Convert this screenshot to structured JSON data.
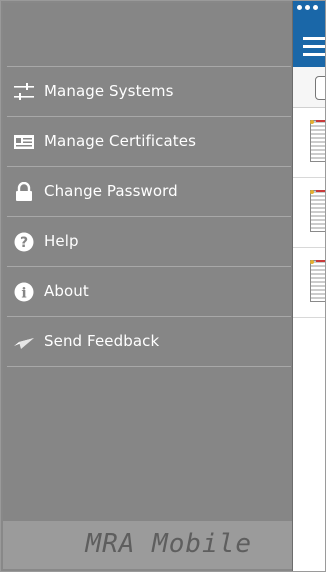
{
  "drawer": {
    "menu": [
      {
        "id": "manage-systems",
        "label": "Manage Systems",
        "icon": "sliders-icon"
      },
      {
        "id": "manage-certificates",
        "label": "Manage Certificates",
        "icon": "certificate-icon"
      },
      {
        "id": "change-password",
        "label": "Change Password",
        "icon": "lock-icon"
      },
      {
        "id": "help",
        "label": "Help",
        "icon": "question-circle-icon"
      },
      {
        "id": "about",
        "label": "About",
        "icon": "info-circle-icon"
      },
      {
        "id": "send-feedback",
        "label": "Send Feedback",
        "icon": "paper-plane-icon"
      }
    ],
    "footer_brand": "MRA Mobile"
  },
  "colors": {
    "drawer_bg": "#868686",
    "header_blue": "#1a67a8",
    "footer_bg": "#9b9b9b"
  }
}
